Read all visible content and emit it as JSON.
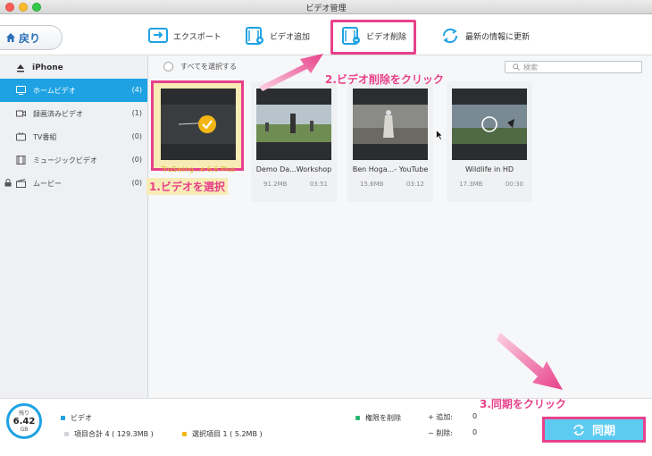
{
  "window": {
    "title": "ビデオ管理"
  },
  "toolbar": {
    "back_label": "戻り",
    "export_label": "エクスポート",
    "add_label": "ビデオ追加",
    "delete_label": "ビデオ削除",
    "refresh_label": "最新の情報に更新"
  },
  "sidebar": {
    "device": "iPhone",
    "items": [
      {
        "label": "ホームビデオ",
        "count": "(4)"
      },
      {
        "label": "録画済みビデオ",
        "count": "(1)"
      },
      {
        "label": "TV番組",
        "count": "(0)"
      },
      {
        "label": "ミュージックビデオ",
        "count": "(0)"
      },
      {
        "label": "ムービー",
        "count": "(0)"
      }
    ]
  },
  "content": {
    "select_all": "すべてを選択する",
    "search_placeholder": "検索",
    "videos": [
      {
        "name": "TruSwing...e 6,6 Plus",
        "size": "",
        "duration": ""
      },
      {
        "name": "Demo Da...Workshop",
        "size": "91.2MB",
        "duration": "03:51"
      },
      {
        "name": "Ben Hoga...- YouTube",
        "size": "15.6MB",
        "duration": "03:12"
      },
      {
        "name": "Wildlife in HD",
        "size": "17.3MB",
        "duration": "00:30"
      }
    ]
  },
  "annotations": {
    "step1": "1.ビデオを選択",
    "step2": "2.ビデオ削除をクリック",
    "step3": "3.同期をクリック"
  },
  "footer": {
    "storage_top": "残り",
    "storage_value": "6.42",
    "storage_unit": "GB",
    "legend_video": "ビデオ",
    "total_items": "項目合計 4 ( 129.3MB )",
    "selected_items": "選択項目 1 ( 5.2MB )",
    "delete_permission": "権限を削除",
    "added_label": "+ 追加:",
    "added_value": "0",
    "deleted_label": "− 削除:",
    "deleted_value": "0",
    "sync_label": "同期"
  },
  "colors": {
    "accent": "#1ea2e3",
    "highlight": "#e8418a",
    "sync_button": "#5ccbf2"
  }
}
